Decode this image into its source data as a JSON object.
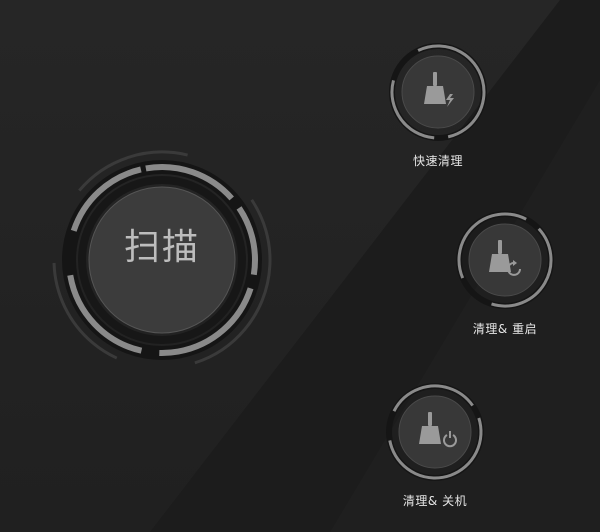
{
  "main": {
    "scan_button_label": "扫描"
  },
  "actions": [
    {
      "id": "quick-clean",
      "label": "快速清理",
      "icon": "broom-lightning-icon"
    },
    {
      "id": "clean-restart",
      "label": "清理& 重启",
      "icon": "broom-restart-icon"
    },
    {
      "id": "clean-shutdown",
      "label": "清理& 关机",
      "icon": "broom-power-icon"
    }
  ],
  "colors": {
    "background": "#232323",
    "ring": "#8c8c8c",
    "ring_dark": "#141414",
    "button_face": "#3a3a3a",
    "icon": "#9a9a9a",
    "text": "#e6e6e6"
  }
}
